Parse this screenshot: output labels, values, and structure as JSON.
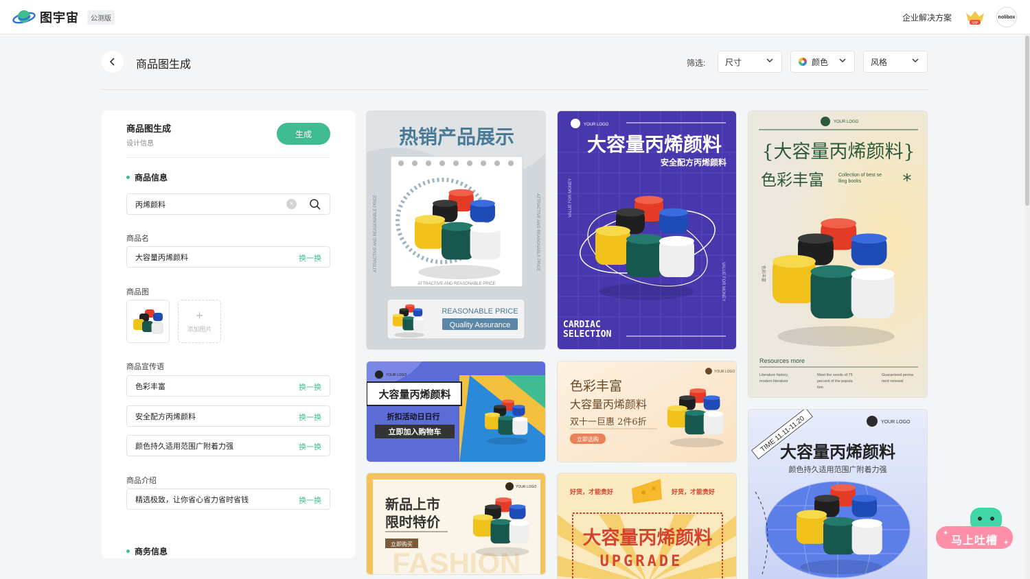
{
  "app": {
    "brand_name": "图宇宙",
    "beta_badge": "公测版",
    "enterprise_link": "企业解决方案",
    "vip_label": "VIP",
    "avatar_text": "nolibox"
  },
  "header": {
    "title": "商品图生成",
    "filter_label": "筛选:",
    "filters": [
      {
        "label": "尺寸"
      },
      {
        "label": "颜色"
      },
      {
        "label": "风格"
      }
    ]
  },
  "panel": {
    "title": "商品图生成",
    "subtitle": "设计信息",
    "generate_label": "生成",
    "product_info_heading": "商品信息",
    "search_value": "丙烯颜料",
    "name_label": "商品名",
    "name_value": "大容量丙烯颜料",
    "swap_label": "换一换",
    "image_label": "商品图",
    "add_image_label": "添加图片",
    "slogan_label": "商品宣传语",
    "slogans": [
      "色彩丰富",
      "安全配方丙烯颜料",
      "颜色持久适用范围广附着力强"
    ],
    "intro_label": "商品介绍",
    "intro_value": "精选极致，让你省心省力省时省钱",
    "business_heading": "商务信息"
  },
  "cards": {
    "c1": {
      "title": "热销产品展示",
      "side_text": "ATTRACTIVE AND REASONABLE PRICE",
      "caption": "ATTRACTIVE AND REASONABLE PRICE",
      "price_tag": "REASONABLE PRICE",
      "quality_tag": "Quality Assurance"
    },
    "c2": {
      "logo": "YOUR LOGO",
      "title": "大容量丙烯颜料",
      "subtitle": "安全配方丙烯颜料",
      "side_text": "VALUE FOR MONEY",
      "footer_line1": "CARDIAC",
      "footer_line2": "SELECTION"
    },
    "c3": {
      "logo": "YOUR LOGO",
      "title": "{大容量丙烯颜料}",
      "subtitle": "色彩丰富",
      "tagline": "Collection of best se",
      "tagline2": "lling books",
      "side_text": "色彩丰富",
      "resources": "Resources more",
      "col1a": "Literature history,",
      "col1b": "modern literature",
      "col2a": "Meet the needs of 75",
      "col2b": "percent of the popula",
      "col2c": "tion",
      "col3a": "Guaranteed perma",
      "col3b": "nent renewal"
    },
    "c4": {
      "logo": "YOUR LOGO",
      "title": "大容量丙烯颜料",
      "subtitle": "折扣活动日日行",
      "button": "立即加入购物车"
    },
    "c5": {
      "logo": "YOUR LOGO",
      "line1": "色彩丰富",
      "line2": "大容量丙烯颜料",
      "line3": "双十一巨惠 2件6折",
      "button": "立即选购"
    },
    "c6": {
      "logo": "YOUR LOGO",
      "badge": "TIME 11.11-11.20",
      "title": "大容量丙烯颜料",
      "subtitle": "颜色持久适用范围广附着力强"
    },
    "c7": {
      "logo": "YOUR LOGO",
      "line1": "新品上市",
      "line2": "限时特价",
      "button": "立即购买",
      "bg_word": "FASHION"
    },
    "c8": {
      "slogan_left": "好货，才能贵好",
      "slogan_right": "好货，才能贵好",
      "title": "大容量丙烯颜料",
      "subtitle": "UPGRADE"
    }
  },
  "feedback": {
    "label": "马上吐槽"
  },
  "colors": {
    "accent": "#3fbc92",
    "purple": "#4b3fb0",
    "blue_card": "#5b6bd8"
  }
}
